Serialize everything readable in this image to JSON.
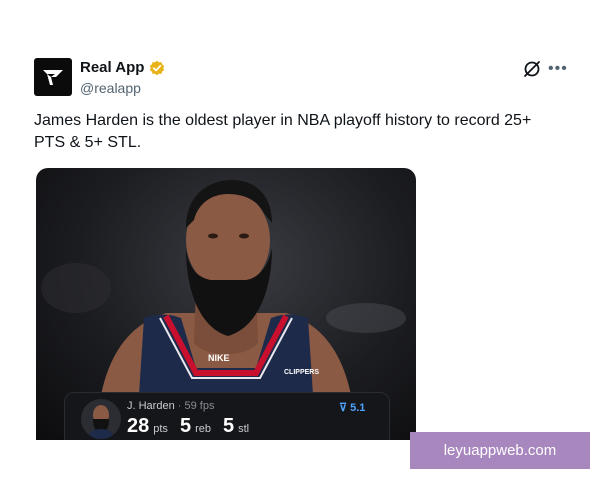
{
  "author": {
    "name": "Real App",
    "handle": "@realapp",
    "verified": true
  },
  "post": {
    "text": "James Harden is the oldest player in NBA playoff history to record 25+ PTS & 5+ STL."
  },
  "media": {
    "jersey_brand": "NIKE",
    "jersey_team": "CLIPPERS",
    "stat_card": {
      "player": "J. Harden",
      "fps": "· 59 fps",
      "score": "5.1",
      "pts_value": "28",
      "pts_label": "pts",
      "reb_value": "5",
      "reb_label": "reb",
      "stl_value": "5",
      "stl_label": "stl"
    }
  },
  "watermark": "leyuappweb.com",
  "colors": {
    "verified_badge": "#e8b318",
    "score_blue": "#4ea3ff",
    "watermark_bg": "#a886be"
  }
}
